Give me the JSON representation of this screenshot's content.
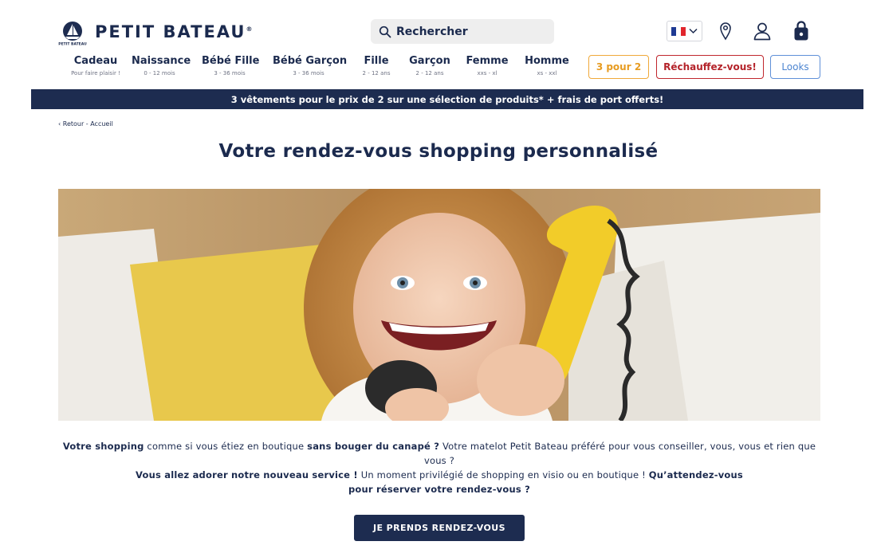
{
  "header": {
    "brand": "PETIT BATEAU",
    "brand_mark": "®",
    "search": {
      "placeholder": "Rechercher"
    },
    "language": "FR",
    "icons": [
      "search-icon",
      "flag-fr-icon",
      "chevron-down-icon",
      "location-pin-icon",
      "account-icon",
      "shopping-bag-icon"
    ]
  },
  "nav": {
    "items": [
      {
        "label": "Cadeau",
        "sub": "Pour faire plaisir !"
      },
      {
        "label": "Naissance",
        "sub": "0 - 12 mois"
      },
      {
        "label": "Bébé Fille",
        "sub": "3 - 36 mois"
      },
      {
        "label": "Bébé Garçon",
        "sub": "3 - 36 mois"
      },
      {
        "label": "Fille",
        "sub": "2 - 12 ans"
      },
      {
        "label": "Garçon",
        "sub": "2 - 12 ans"
      },
      {
        "label": "Femme",
        "sub": "xxs - xl"
      },
      {
        "label": "Homme",
        "sub": "xs - xxl"
      }
    ],
    "pills": {
      "three_for_two": "3 pour 2",
      "rechauffez": "Réchauffez-vous!",
      "looks": "Looks"
    }
  },
  "banner": {
    "text": "3 vêtements pour le prix de 2 sur une sélection de produits* + frais de port offerts!"
  },
  "breadcrumb": {
    "back_label": "‹ Retour - Accueil"
  },
  "main": {
    "title": "Votre rendez-vous shopping personnalisé",
    "intro": {
      "p1_b1": "Votre shopping",
      "p1_t1": " comme si vous étiez en boutique ",
      "p1_b2": "sans bouger du canapé ?",
      "p1_t2": " Votre matelot Petit Bateau préféré pour vous conseiller, vous, vous et rien que vous ?",
      "p2_b1": "Vous allez adorer notre nouveau service !",
      "p2_t1": " Un moment privilégié de shopping en visio ou en boutique ! ",
      "p2_b2": "Qu’attendez-vous pour réserver votre rendez-vous ?"
    },
    "cta_label": "JE PRENDS RENDEZ-VOUS"
  },
  "colors": {
    "navy": "#1d2c50",
    "orange": "#e79c22",
    "red": "#b4232a",
    "blue": "#4d85d0",
    "flag_blue": "#1f3a93",
    "flag_red": "#e1262d"
  }
}
